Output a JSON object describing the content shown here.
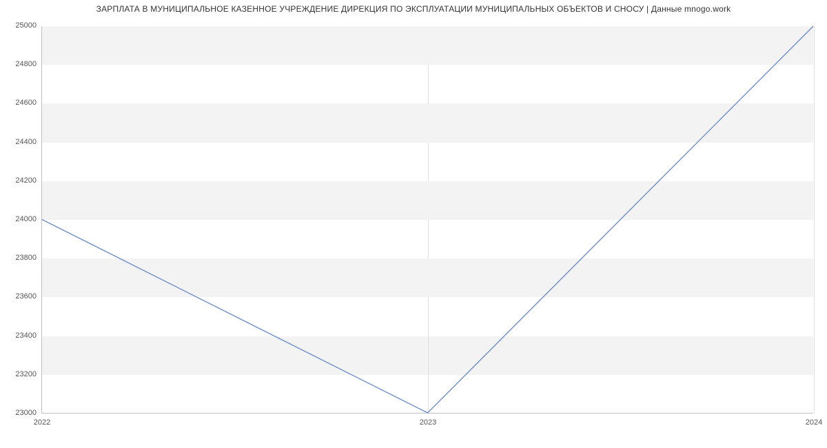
{
  "chart_data": {
    "type": "line",
    "title": "ЗАРПЛАТА В МУНИЦИПАЛЬНОЕ КАЗЕННОЕ УЧРЕЖДЕНИЕ ДИРЕКЦИЯ ПО ЭКСПЛУАТАЦИИ МУНИЦИПАЛЬНЫХ ОБЪЕКТОВ И СНОСУ | Данные mnogo.work",
    "xlabel": "",
    "ylabel": "",
    "x": [
      "2022",
      "2023",
      "2024"
    ],
    "values": [
      24000,
      23000,
      25000
    ],
    "y_ticks": [
      23000,
      23200,
      23400,
      23600,
      23800,
      24000,
      24200,
      24400,
      24600,
      24800,
      25000
    ],
    "x_ticks": [
      "2022",
      "2023",
      "2024"
    ],
    "ylim": [
      23000,
      25000
    ],
    "grid": true,
    "line_color": "#6e8fce",
    "band_color": "#f3f3f3"
  }
}
